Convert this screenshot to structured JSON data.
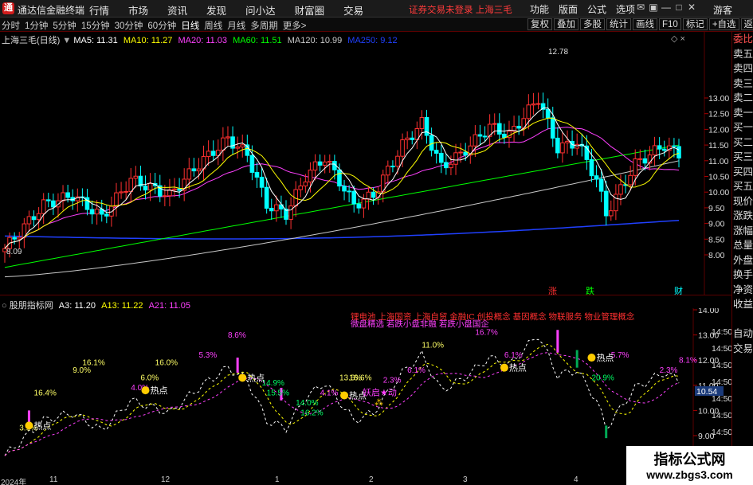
{
  "app": {
    "title": "通达信金融终端",
    "menu": [
      "行情",
      "市场",
      "资讯",
      "发现",
      "问小达",
      "财富圈",
      "交易"
    ],
    "notice": "证券交易未登录",
    "stock_notice": "上海三毛",
    "right_menu": [
      "功能",
      "版面",
      "公式",
      "选项"
    ],
    "window_controls": [
      "✉",
      "▣",
      "—",
      "□",
      "✕"
    ],
    "guest": "游客"
  },
  "toolbar": {
    "periods": [
      "分时",
      "1分钟",
      "5分钟",
      "15分钟",
      "30分钟",
      "60分钟",
      "日线",
      "周线",
      "月线",
      "多周期",
      "更多>"
    ],
    "active_period": "日线",
    "tools": [
      "复权",
      "叠加",
      "多股",
      "统计",
      "画线",
      "F10",
      "标记",
      "+自选",
      "返回"
    ]
  },
  "main_legend": {
    "stock": "上海三毛(日线)",
    "ma5": "MA5: 11.31",
    "ma10": "MA10: 11.27",
    "ma20": "MA20: 11.03",
    "ma60": "MA60: 11.51",
    "ma120": "MA120: 10.99",
    "ma250": "MA250: 9.12",
    "controls": "◇ ×",
    "colors": {
      "ma5": "#ffffff",
      "ma10": "#ffff00",
      "ma20": "#ff40ff",
      "ma60": "#00ff00",
      "ma120": "#c8c8c8",
      "ma250": "#2040ff"
    }
  },
  "sub_legend": {
    "name": "股朋指标网",
    "a3": "A3: 11.20",
    "a13": "A13: 11.22",
    "a21": "A21: 11.05"
  },
  "right_panel": [
    "委比",
    "卖五",
    "卖四",
    "卖三",
    "卖二",
    "卖一",
    "买一",
    "买二",
    "买三",
    "买四",
    "买五",
    "现价",
    "涨跌",
    "涨幅",
    "总量",
    "外盘",
    "换手",
    "净资",
    "收益",
    "",
    "自动",
    "交易"
  ],
  "main_axis": {
    "ticks": [
      13.0,
      12.5,
      12.0,
      11.5,
      11.0,
      10.5,
      10.0,
      9.5,
      9.0,
      8.5,
      8.0
    ],
    "tick_labels": [
      "13.00",
      "12.50",
      "12.00",
      "11.50",
      "11.00",
      "10.50",
      "10.00",
      "9.50",
      "9.00",
      "8.50",
      "8.00"
    ],
    "high_label": "12.78",
    "low_label": "8.09",
    "marks": [
      "涨",
      "跌",
      "财"
    ]
  },
  "sub_axis": {
    "ticks": [
      14.0,
      13.0,
      12.0,
      11.0,
      10.0,
      9.0
    ],
    "tick_labels": [
      "14.00",
      "13.00",
      "12.00",
      "11.00",
      "10.00",
      "9.00"
    ],
    "overflow_labels": [
      "14:50",
      "14:50",
      "14:50",
      "14:50",
      "14:50",
      "14:50",
      "14:50",
      "14:50"
    ],
    "current": "10.54"
  },
  "sub_annotations": {
    "percents": [
      "3.9%",
      "16.4%",
      "16.1%",
      "9.0%",
      "6.0%",
      "4.0%",
      "16.0%",
      "5.3%",
      "8.6%",
      "14.9%",
      "15.5%",
      "14.0%",
      "4.1%",
      "16.2%",
      "13.6%",
      "16.6%",
      "2.3%",
      "6.1%",
      "11.0%",
      "16.7%",
      "6.1%",
      "5.7%",
      "20.9%",
      "2.3%",
      "8.1%"
    ],
    "hot": "热点",
    "signal": "妖启★动",
    "concept_line": "锂电池 上海国资 上海自贸 金融IC 创投概念 基因概念 物联服务 物业管理概念",
    "concept_line2": "微盘精选 若跌小盘非融 若跌小盘国企"
  },
  "bottom_axis": {
    "year": "2024年",
    "months": [
      "11",
      "12",
      "1",
      "2",
      "3",
      "4"
    ]
  },
  "watermark": {
    "line1": "指标公式网",
    "line2": "www.zbgs3.com"
  }
}
